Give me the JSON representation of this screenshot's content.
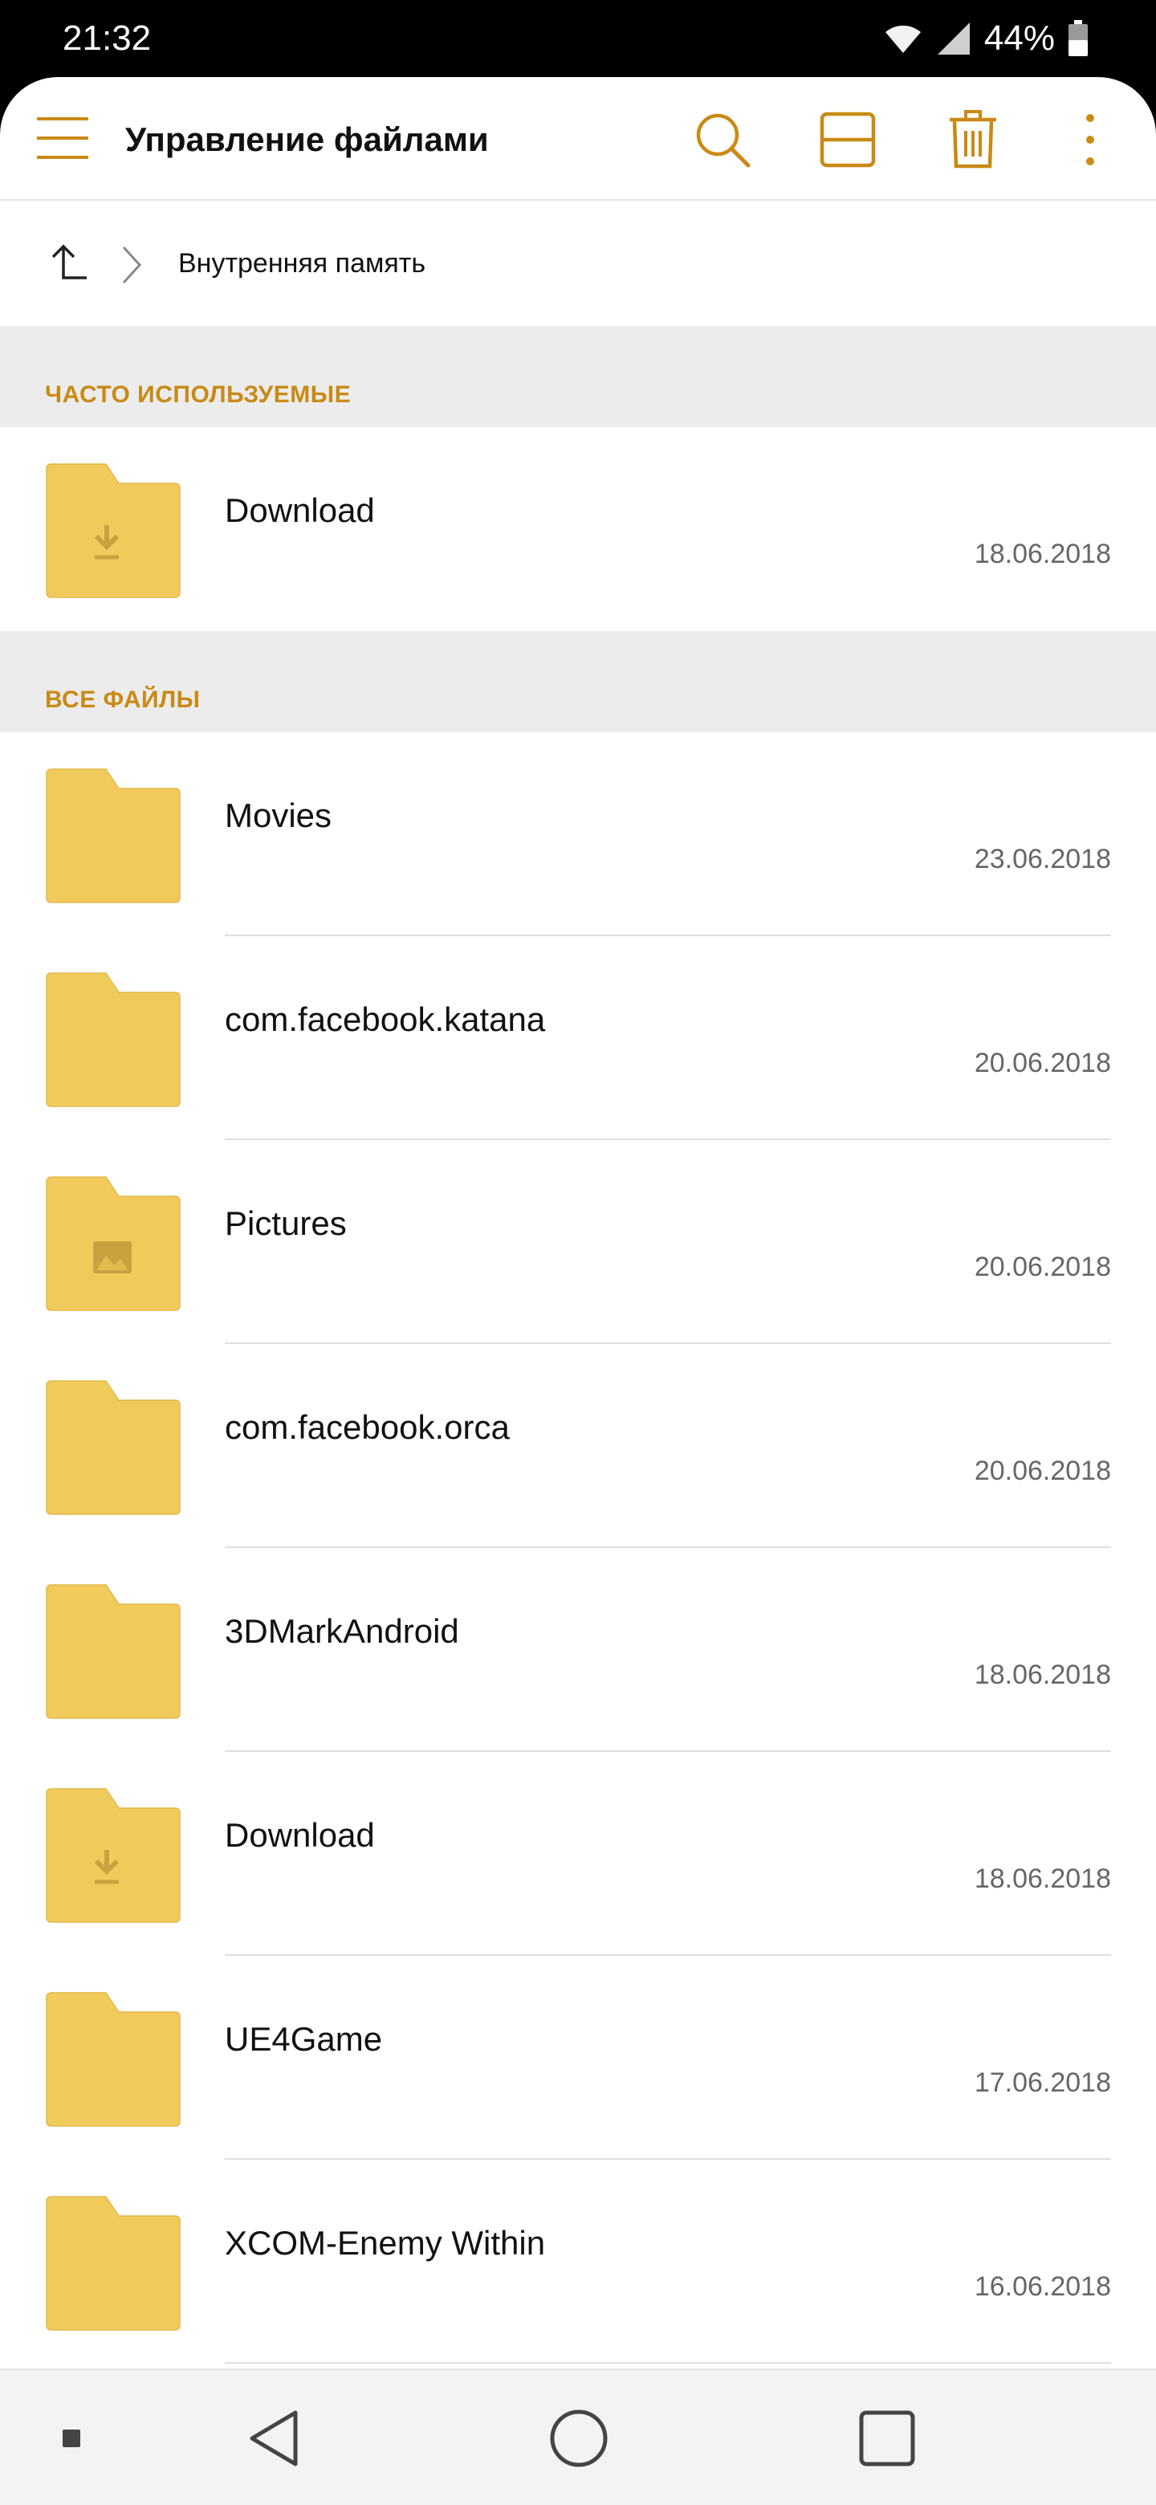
{
  "status_bar": {
    "time": "21:32",
    "battery_percent": "44%",
    "icons": [
      "wifi-icon",
      "cell-signal-icon",
      "battery-icon"
    ]
  },
  "toolbar": {
    "title": "Управление файлами",
    "actions": [
      "menu-icon",
      "search-icon",
      "view-toggle-icon",
      "delete-icon",
      "more-icon"
    ]
  },
  "breadcrumb": {
    "current": "Внутренняя память"
  },
  "sections": {
    "frequent": {
      "title": "ЧАСТО ИСПОЛЬЗУЕМЫЕ",
      "items": [
        {
          "name": "Download",
          "date": "18.06.2018",
          "icon": "download-folder-icon"
        }
      ]
    },
    "all": {
      "title": "ВСЕ ФАЙЛЫ",
      "items": [
        {
          "name": "Movies",
          "date": "23.06.2018",
          "icon": "folder-icon"
        },
        {
          "name": "com.facebook.katana",
          "date": "20.06.2018",
          "icon": "folder-icon"
        },
        {
          "name": "Pictures",
          "date": "20.06.2018",
          "icon": "pictures-folder-icon"
        },
        {
          "name": "com.facebook.orca",
          "date": "20.06.2018",
          "icon": "folder-icon"
        },
        {
          "name": "3DMarkAndroid",
          "date": "18.06.2018",
          "icon": "folder-icon"
        },
        {
          "name": "Download",
          "date": "18.06.2018",
          "icon": "download-folder-icon"
        },
        {
          "name": "UE4Game",
          "date": "17.06.2018",
          "icon": "folder-icon"
        },
        {
          "name": "XCOM-Enemy Within",
          "date": "16.06.2018",
          "icon": "folder-icon"
        }
      ]
    }
  },
  "nav_bar": {
    "buttons": [
      "small-square-icon",
      "back-icon",
      "home-icon",
      "recents-icon"
    ]
  },
  "colors": {
    "accent": "#C98A16",
    "folder": "#F0CB5C",
    "folder_glyph": "#C9A23E",
    "section_bg": "#ECECEC"
  }
}
